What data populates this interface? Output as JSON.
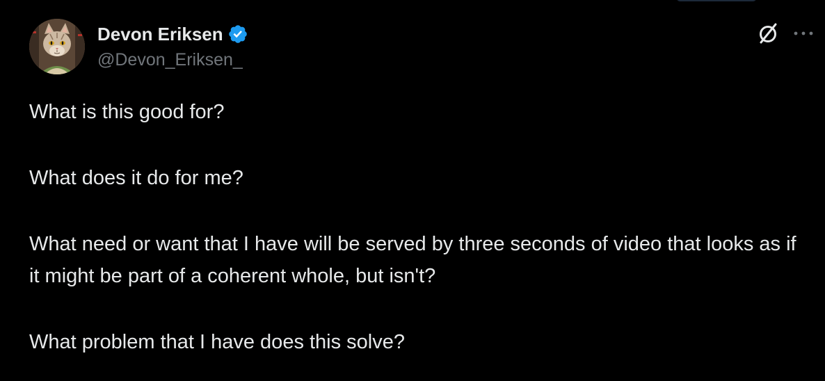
{
  "author": {
    "display_name": "Devon Eriksen",
    "handle": "@Devon_Eriksen_",
    "verified": true
  },
  "icons": {
    "avatar": "cat-avatar",
    "verified": "verified-badge-icon",
    "grok": "grok-icon",
    "more": "more-options-icon"
  },
  "colors": {
    "background": "#000000",
    "text": "#e7e9ea",
    "secondary": "#71767b",
    "verified_blue": "#1d9bf0"
  },
  "tweet": {
    "paragraphs": [
      "What is this good for?",
      "What does it do for me?",
      "What need or want that I have will be served by three seconds of video that looks as if it might be part of a coherent whole, but isn't?",
      "What problem that I have does this solve?"
    ]
  }
}
